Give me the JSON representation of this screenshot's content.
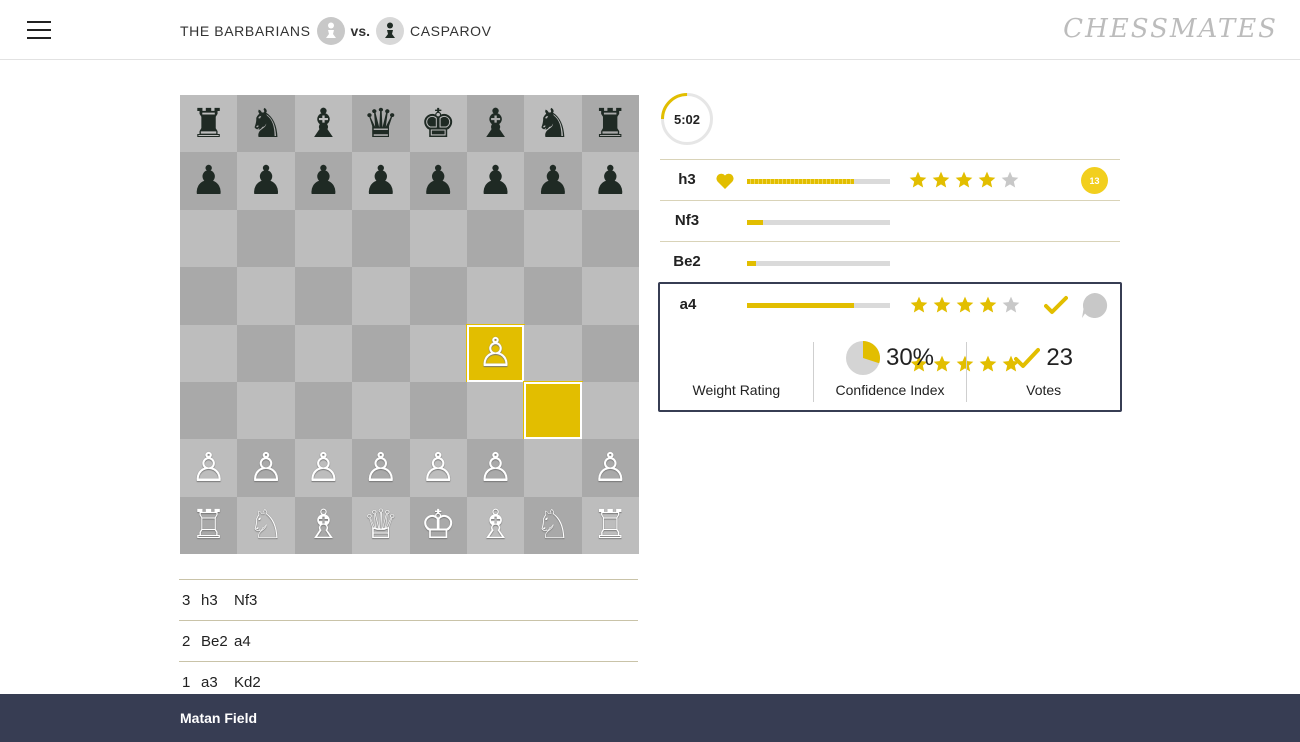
{
  "header": {
    "player_white": "THE BARBARIANS",
    "vs": "vs.",
    "player_black": "CASPAROV",
    "logo": "CHESSMATES",
    "menu_icon": "hamburger-icon"
  },
  "board": {
    "rows": [
      [
        "♜",
        "♞",
        "♝",
        "♛",
        "♚",
        "♝",
        "♞",
        "♜"
      ],
      [
        "♟",
        "♟",
        "♟",
        "♟",
        "♟",
        "♟",
        "♟",
        "♟"
      ],
      [
        "",
        "",
        "",
        "",
        "",
        "",
        "",
        ""
      ],
      [
        "",
        "",
        "",
        "",
        "",
        "",
        "",
        ""
      ],
      [
        "",
        "",
        "",
        "",
        "",
        "♙",
        "",
        ""
      ],
      [
        "",
        "",
        "",
        "",
        "",
        "",
        "",
        ""
      ],
      [
        "♙",
        "♙",
        "♙",
        "♙",
        "♙",
        "♙",
        "",
        "♙"
      ],
      [
        "♖",
        "♘",
        "♗",
        "♕",
        "♔",
        "♗",
        "♘",
        "♖"
      ]
    ],
    "colors": [
      [
        "b",
        "b",
        "b",
        "b",
        "b",
        "b",
        "b",
        "b"
      ],
      [
        "b",
        "b",
        "b",
        "b",
        "b",
        "b",
        "b",
        "b"
      ],
      [
        "",
        "",
        "",
        "",
        "",
        "",
        "",
        ""
      ],
      [
        "",
        "",
        "",
        "",
        "",
        "",
        "",
        ""
      ],
      [
        "",
        "",
        "",
        "",
        "",
        "w",
        "",
        ""
      ],
      [
        "",
        "",
        "",
        "",
        "",
        "",
        "",
        ""
      ],
      [
        "w",
        "w",
        "w",
        "w",
        "w",
        "w",
        "",
        "w"
      ],
      [
        "w",
        "w",
        "w",
        "w",
        "w",
        "w",
        "w",
        "w"
      ]
    ],
    "highlighted": [
      "f4",
      "g3"
    ],
    "highlight_color": "#e2be00"
  },
  "history": [
    {
      "n": "3",
      "m1": "h3",
      "m2": "Nf3"
    },
    {
      "n": "2",
      "m1": "Be2",
      "m2": "a4"
    },
    {
      "n": "1",
      "m1": "a3",
      "m2": "Kd2"
    }
  ],
  "timer": {
    "label": "5:02",
    "progress": 0.25
  },
  "candidates": [
    {
      "move": "h3",
      "favorite": true,
      "bar": 0.75,
      "stars": 4,
      "comments": "13"
    },
    {
      "move": "Nf3",
      "bar": 0.11
    },
    {
      "move": "Be2",
      "bar": 0.06
    }
  ],
  "selected": {
    "move": "a4",
    "bar": 0.75,
    "stars": 4,
    "voted": true,
    "weight_stars": 5,
    "weight_label": "Weight Rating",
    "confidence_value": "30%",
    "confidence_fraction": 0.3,
    "confidence_label": "Confidence Index",
    "votes_value": "23",
    "votes_label": "Votes"
  },
  "footer": {
    "user": "Matan Field"
  },
  "colors": {
    "accent": "#e2be00",
    "footer": "#373d53"
  }
}
